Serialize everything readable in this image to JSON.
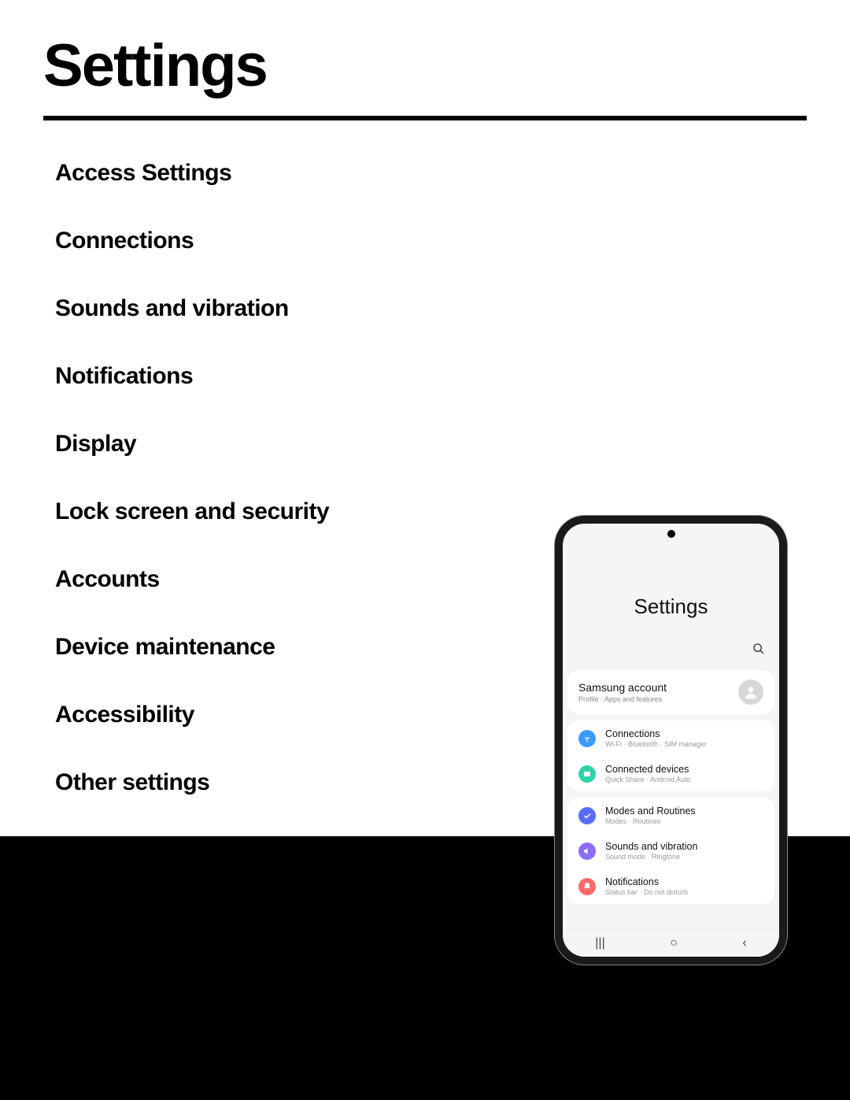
{
  "page_title": "Settings",
  "toc": [
    "Access Settings",
    "Connections",
    "Sounds and vibration",
    "Notifications",
    "Display",
    "Lock screen and security",
    "Accounts",
    "Device maintenance",
    "Accessibility",
    "Other settings"
  ],
  "phone": {
    "header": "Settings",
    "account": {
      "title": "Samsung account",
      "subtitle": "Profile · Apps and features"
    },
    "group1": [
      {
        "icon": "wifi",
        "color": "ic-blue",
        "title": "Connections",
        "subtitle": "Wi-Fi · Bluetooth · SIM manager"
      },
      {
        "icon": "devices",
        "color": "ic-teal",
        "title": "Connected devices",
        "subtitle": "Quick Share · Android Auto"
      }
    ],
    "group2": [
      {
        "icon": "check",
        "color": "ic-indigo",
        "title": "Modes and Routines",
        "subtitle": "Modes · Routines"
      },
      {
        "icon": "sound",
        "color": "ic-purple",
        "title": "Sounds and vibration",
        "subtitle": "Sound mode · Ringtone"
      },
      {
        "icon": "bell",
        "color": "ic-red",
        "title": "Notifications",
        "subtitle": "Status bar · Do not disturb"
      }
    ],
    "nav": {
      "recent": "|||",
      "home": "○",
      "back": "‹"
    }
  }
}
